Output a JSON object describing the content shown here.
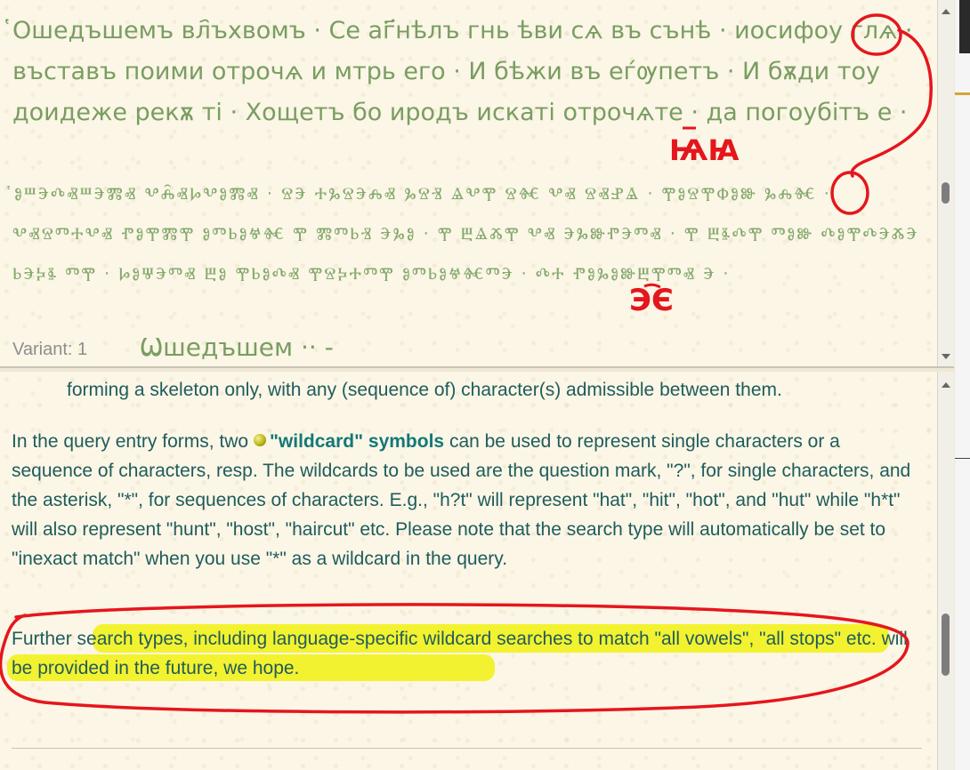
{
  "top_pane": {
    "cyrillic_text": "҅Ошедъшемъ вл҄ъхвомъ · Се аг҃нѣлъ гнь ѣви сѧ въ сънѣ · иосифоу глѧ · въставъ поими отрочѧ и мтрь его · И бѣжи въ еѓѹпетъ · И бѫди тоу доидеже рекѫ ті · Хощетъ бо иродъ искаті отрочѧте · да погоубітъ е ·",
    "glagolitic_text": "҅ⰑⰞⰅⰄⰟⰞⰅⰏⰟ ⰂⰎ҄ⰟⰘⰂⰑⰏⰟ · ⰔⰅ ⰀⰃⰔⰅⰎⰟ ⰃⰔⰠ ⰡⰂⰉ ⰔⰩ ⰂⰟ ⰔⰟⰐⰡ · ⰉⰑⰔⰉⰗⰑⰖ ⰃⰎⰩ · ⰂⰟⰔⰕⰀⰂⰟ ⰒⰑⰉⰏⰉ ⰑⰕⰓⰑⰝⰩ Ⰹ ⰏⰕⰓⰠ ⰅⰃⰑ · Ⰹ ⰁⰡⰆⰉ ⰂⰟ ⰅⰃⰖⰒⰅⰕⰟ · Ⰹ ⰁⰫⰄⰉ ⰕⰑⰖ ⰄⰑⰉⰄⰅⰆⰅ ⰓⰅⰍⰫ ⰕⰉ · ⰘⰑⰛⰅⰕⰟ ⰁⰑ ⰉⰓⰑⰄⰟ ⰉⰔⰍⰀⰕⰉ ⰑⰕⰓⰑⰝⰩⰕⰅ · ⰄⰀ ⰒⰑⰃⰑⰖⰁⰉⰕⰟ Ⰵ ·",
    "variant_label": "Variant: 1",
    "variant_word": "Ѡшедъшем ·· -",
    "correction_1": "ѨꙖ",
    "correction_2": "ЭЄ"
  },
  "bottom_pane": {
    "top_line": "forming a skeleton only, with any (sequence of) character(s) admissible between them.",
    "para1_before": "In the query entry forms, two",
    "para1_link": "\"wildcard\" symbols",
    "para1_after": "can be used to represent single characters or a sequence of characters, resp. The wildcards to be used are the question mark, \"?\", for single characters, and the asterisk, \"*\", for sequences of characters. E.g., \"h?t\" will represent \"hat\", \"hit\", \"hot\", and \"hut\" while \"h*t\" will also represent \"hunt\", \"host\", \"haircut\" etc. Please note that the search type will automatically be set to \"inexact match\" when you use \"*\" as a wildcard in the query.",
    "para2": "Further search types, including language-specific wildcard searches to match \"all vowels\", \"all stops\" etc. will be provided in the future, we hope."
  },
  "colors": {
    "ocs_text": "#7a9d62",
    "help_text": "#1f5c5c",
    "link": "#137878",
    "annotation_red": "#e5161d",
    "highlight": "#f2f21c"
  },
  "icons": [
    "scroll-up-arrow",
    "scroll-down-arrow",
    "bullet-icon"
  ]
}
